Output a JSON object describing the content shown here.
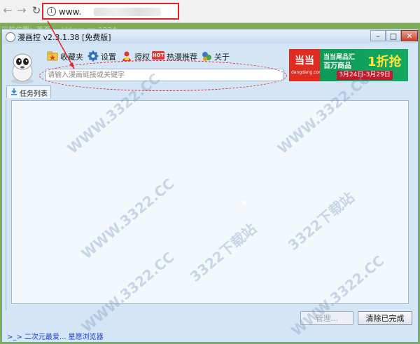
{
  "browser": {
    "address_text": "www.",
    "info_icon": "i"
  },
  "background": {
    "text": "当前位置：首页 ... kkkom.rm 1234... "
  },
  "window": {
    "title": "漫画控 v2.3.1.38 [免费版]",
    "buttons": {
      "minimize": "–",
      "maximize": "□",
      "close": "✕"
    }
  },
  "toolbar": {
    "items": [
      {
        "label": "收藏夹",
        "icon": "folder-star-icon"
      },
      {
        "label": "设置",
        "icon": "gear-icon"
      },
      {
        "label": "授权",
        "icon": "vip-user-icon"
      },
      {
        "label": "热漫推荐",
        "icon": "hot-badge-icon",
        "badge": "HOT"
      },
      {
        "label": "关于",
        "icon": "about-icon"
      }
    ]
  },
  "search": {
    "placeholder": "请输入漫画链接或关键字",
    "value": ""
  },
  "ad": {
    "logo_mark": "当当",
    "logo_text": "dangdang.com",
    "line1": "当当尾品汇",
    "line2": "百万商品",
    "big": "1折抢",
    "dates": "3月24日-3月29日"
  },
  "tabs": [
    {
      "label": "任务列表"
    }
  ],
  "buttons": {
    "manage": "管理...",
    "clear_done": "清除已完成"
  },
  "status_link": ">_> 二次元最爱... 星愿浏览器",
  "watermark": {
    "text": "WWW.3322.CC",
    "text2": "3322下载站"
  },
  "colors": {
    "annotation_red": "#e0232b",
    "window_bg": "#d4e6f5",
    "list_bg": "#f3f8fd",
    "desktop_green": "#7fae52"
  }
}
